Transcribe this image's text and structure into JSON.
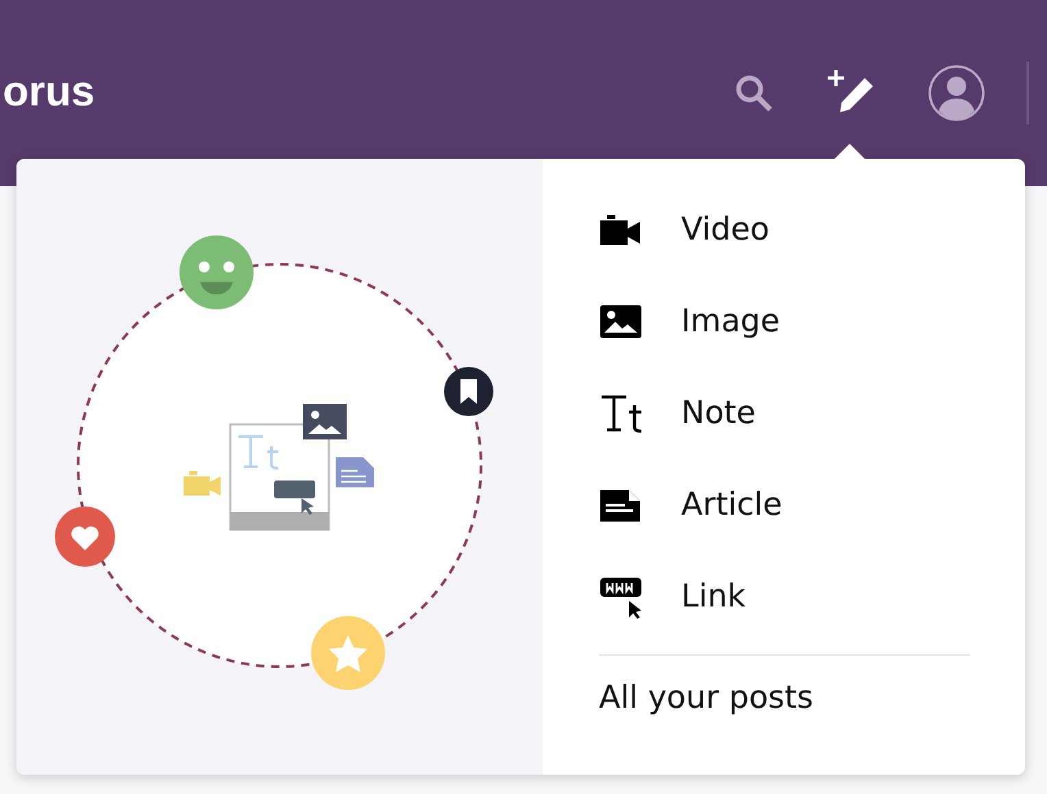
{
  "header": {
    "logo": "orus"
  },
  "menu": {
    "items": [
      {
        "kind": "video",
        "label": "Video"
      },
      {
        "kind": "image",
        "label": "Image"
      },
      {
        "kind": "note",
        "label": "Note"
      },
      {
        "kind": "article",
        "label": "Article"
      },
      {
        "kind": "link",
        "label": "Link"
      }
    ],
    "footer_link": "All your posts"
  }
}
